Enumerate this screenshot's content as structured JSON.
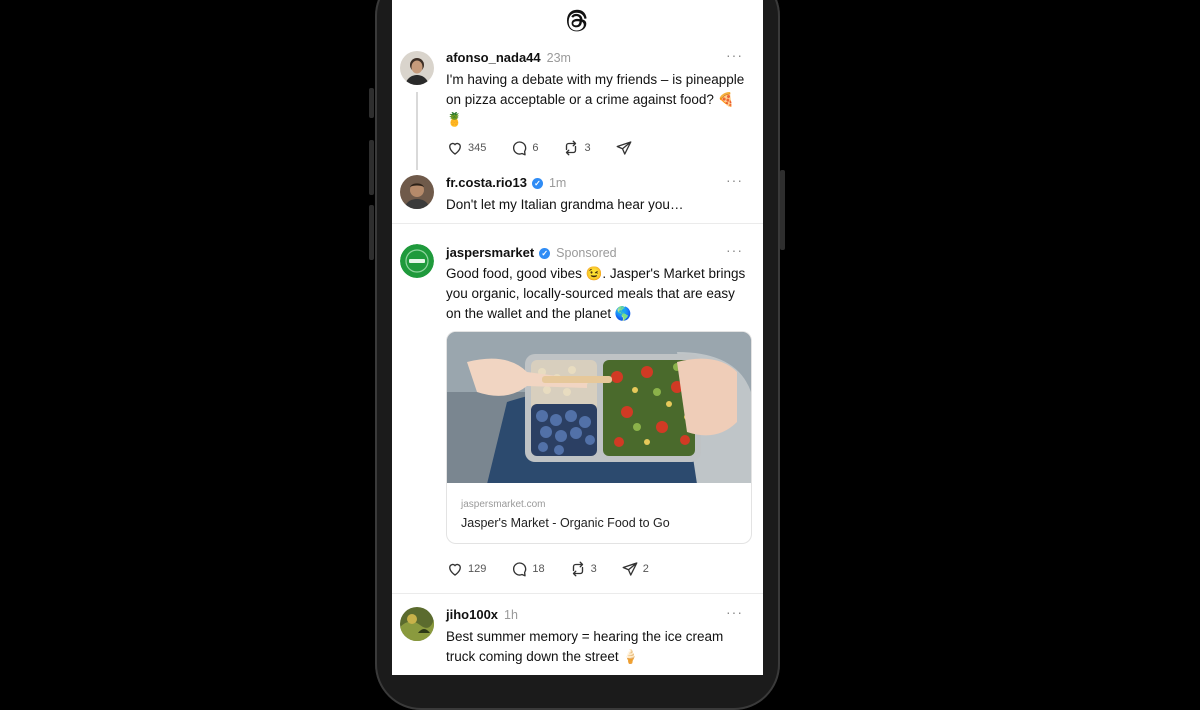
{
  "app": {
    "logo_icon": "threads-logo-icon"
  },
  "posts": [
    {
      "username": "afonso_nada44",
      "time": "23m",
      "text": "I'm having a debate with my friends – is pineapple on pizza acceptable or a crime against food? 🍕🍍",
      "likes": "345",
      "replies": "6",
      "reposts": "3",
      "more_label": "···"
    },
    {
      "username": "fr.costa.rio13",
      "time": "1m",
      "verified": true,
      "text": "Don't let my Italian grandma hear you…",
      "more_label": "···"
    },
    {
      "username": "jaspersmarket",
      "verified": true,
      "sponsored_label": "Sponsored",
      "text": "Good food, good vibes 😉. Jasper's Market brings you organic, locally-sourced meals that are easy on the wallet and the planet 🌎",
      "link_domain": "jaspersmarket.com",
      "link_title": "Jasper's Market - Organic Food to Go",
      "likes": "129",
      "replies": "18",
      "reposts": "3",
      "shares": "2",
      "more_label": "···"
    },
    {
      "username": "jiho100x",
      "time": "1h",
      "text": "Best summer memory = hearing the ice cream truck coming down the street 🍦",
      "more_label": "···"
    }
  ],
  "colors": {
    "verified": "#2f8cf5",
    "meta": "#9a9a9a",
    "background": "#000000",
    "screen": "#ffffff"
  }
}
